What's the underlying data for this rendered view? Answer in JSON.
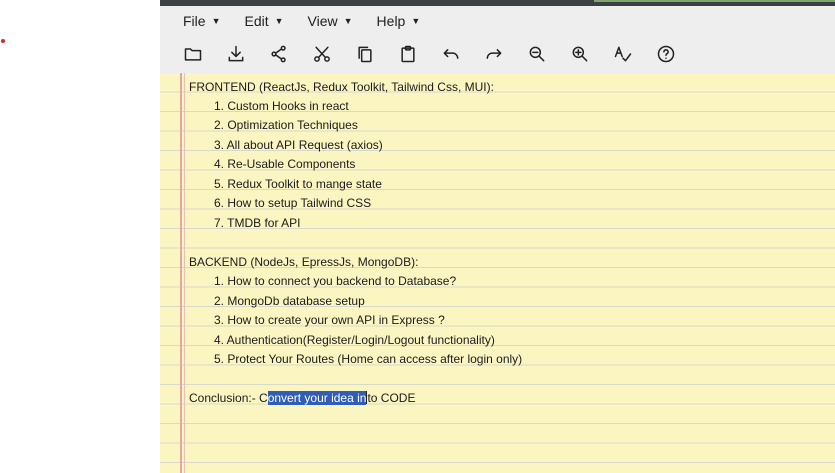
{
  "menus": [
    {
      "label": "File"
    },
    {
      "label": "Edit"
    },
    {
      "label": "View"
    },
    {
      "label": "Help"
    }
  ],
  "toolbar": [
    {
      "icon": "folder-open-icon"
    },
    {
      "icon": "download-icon"
    },
    {
      "icon": "share-icon"
    },
    {
      "icon": "cut-icon"
    },
    {
      "icon": "copy-icon"
    },
    {
      "icon": "paste-icon"
    },
    {
      "icon": "undo-icon"
    },
    {
      "icon": "redo-icon"
    },
    {
      "icon": "zoom-out-icon"
    },
    {
      "icon": "zoom-in-icon"
    },
    {
      "icon": "spellcheck-icon"
    },
    {
      "icon": "help-icon"
    }
  ],
  "document": {
    "frontend_heading": "FRONTEND (ReactJs, Redux Toolkit, Tailwind Css, MUI):",
    "frontend_items": [
      "1. Custom Hooks in react",
      "2. Optimization Techniques",
      "3. All about API Request (axios)",
      "4. Re-Usable Components",
      "5. Redux Toolkit to mange state",
      "6. How to setup Tailwind CSS",
      "7. TMDB for API"
    ],
    "backend_heading": "BACKEND (NodeJs, EpressJs, MongoDB):",
    "backend_items": [
      "1. How to connect you backend to Database?",
      "2. MongoDb database setup",
      "3. How to create your own API in Express ?",
      "4. Authentication(Register/Login/Logout functionality)",
      "5. Protect Your Routes (Home can access after login only)"
    ],
    "conclusion": {
      "prefix": "Conclusion:- C",
      "selected": "onvert your idea in",
      "suffix": "to CODE"
    }
  },
  "colors": {
    "paper": "#fbf5c2",
    "margin_rule": "#e2a9a0",
    "selection": "#2f5db8"
  }
}
